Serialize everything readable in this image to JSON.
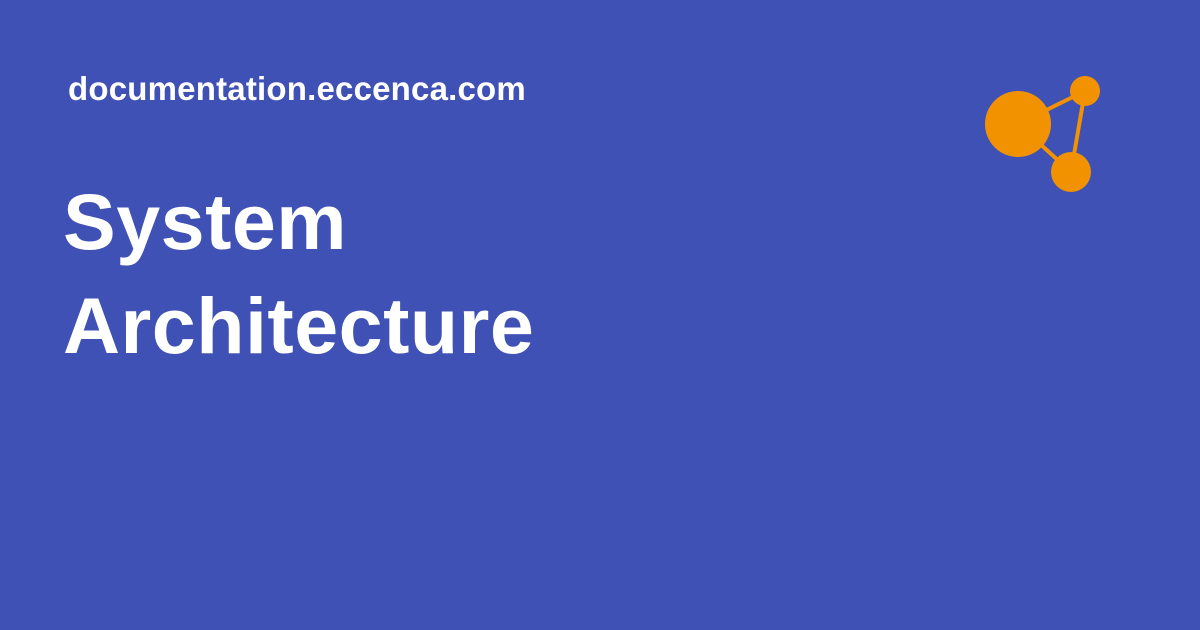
{
  "site": {
    "url": "documentation.eccenca.com"
  },
  "page": {
    "title_line1": "System",
    "title_line2": "Architecture"
  },
  "brand": {
    "background_color": "#3f51b5",
    "accent_color": "#f39200",
    "text_color": "#ffffff",
    "logo_icon": "graph-nodes-icon"
  }
}
